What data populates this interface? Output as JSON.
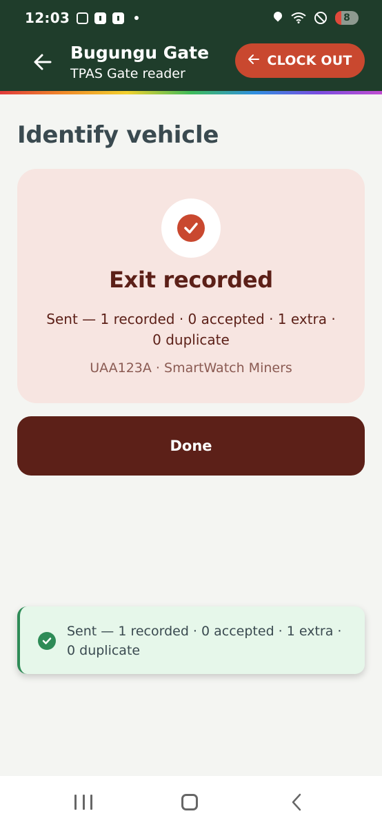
{
  "status_bar": {
    "time": "12:03",
    "left_icons": [
      "screenshot-icon",
      "camera-icon",
      "alert-icon",
      "dot-icon"
    ],
    "right_icons": [
      "location-icon",
      "wifi-icon",
      "do-not-disturb-icon"
    ],
    "battery_level": "8",
    "colors": {
      "background": "#1f3d2b",
      "battery_low": "#e0493b"
    }
  },
  "app_bar": {
    "back_icon": "arrow-left-icon",
    "title": "Bugungu Gate",
    "subtitle": "TPAS Gate reader",
    "clock_out_icon": "arrow-left-icon",
    "clock_out_label": "CLOCK OUT",
    "colors": {
      "background": "#1f3d2b",
      "clock_out": "#c9482f"
    }
  },
  "main": {
    "page_title": "Identify vehicle",
    "result_card": {
      "icon": "check-circle-icon",
      "title": "Exit recorded",
      "detail": "Sent — 1 recorded · 0 accepted · 1 extra · 0 duplicate",
      "meta": "UAA123A · SmartWatch Miners",
      "colors": {
        "background": "#f7e5e1",
        "accent": "#c9482f",
        "text": "#5c2018"
      }
    },
    "done_button": {
      "label": "Done",
      "color": "#5c2018"
    }
  },
  "toast": {
    "icon": "check-circle-icon",
    "message": "Sent — 1 recorded · 0 accepted · 1 extra · 0 duplicate",
    "colors": {
      "background": "#e6f7ea",
      "accent": "#2e8b57"
    }
  },
  "nav_bar": {
    "icons": [
      "recents-icon",
      "home-icon",
      "back-icon"
    ]
  }
}
